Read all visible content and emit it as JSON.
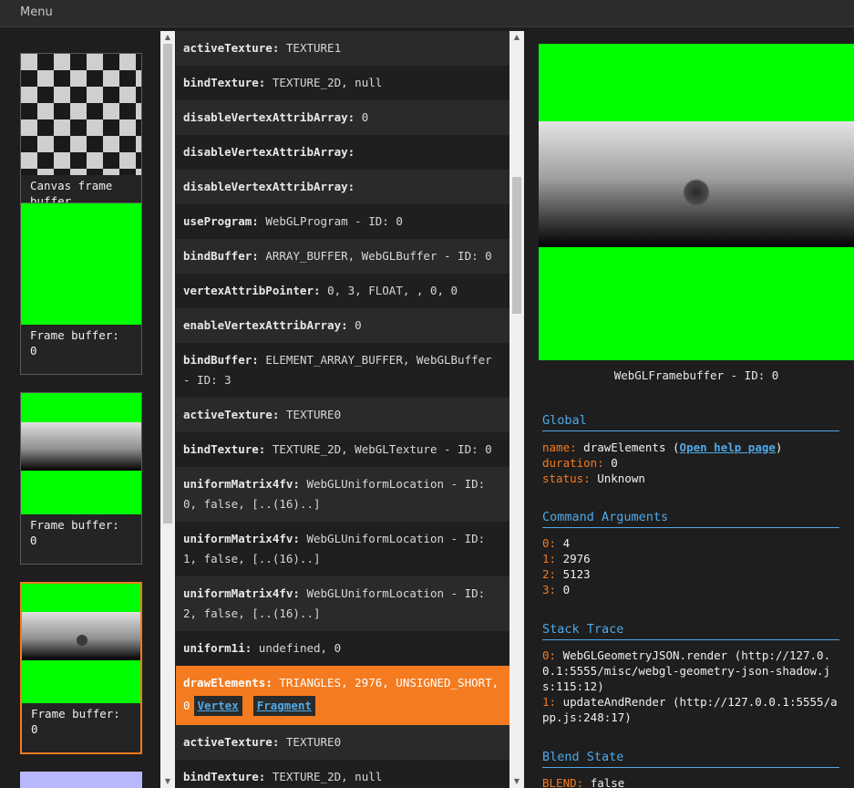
{
  "menu": {
    "label": "Menu"
  },
  "thumbnails": [
    {
      "label": "Canvas frame\nbuffer"
    },
    {
      "label": "Frame buffer:\n0"
    },
    {
      "label": "Frame buffer:\n0"
    },
    {
      "label": "Frame buffer:\n0"
    }
  ],
  "commands": [
    {
      "name": "activeTexture",
      "args": "TEXTURE1"
    },
    {
      "name": "bindTexture",
      "args": "TEXTURE_2D, null"
    },
    {
      "name": "disableVertexAttribArray",
      "args": "0"
    },
    {
      "name": "disableVertexAttribArray",
      "args": ""
    },
    {
      "name": "disableVertexAttribArray",
      "args": ""
    },
    {
      "name": "useProgram",
      "args": "WebGLProgram - ID: 0"
    },
    {
      "name": "bindBuffer",
      "args": "ARRAY_BUFFER, WebGLBuffer - ID: 0"
    },
    {
      "name": "vertexAttribPointer",
      "args": "0, 3, FLOAT, , 0, 0"
    },
    {
      "name": "enableVertexAttribArray",
      "args": "0"
    },
    {
      "name": "bindBuffer",
      "args": "ELEMENT_ARRAY_BUFFER, WebGLBuffer - ID: 3"
    },
    {
      "name": "activeTexture",
      "args": "TEXTURE0"
    },
    {
      "name": "bindTexture",
      "args": "TEXTURE_2D, WebGLTexture - ID: 0"
    },
    {
      "name": "uniformMatrix4fv",
      "args": "WebGLUniformLocation - ID: 0, false, [..(16)..]"
    },
    {
      "name": "uniformMatrix4fv",
      "args": "WebGLUniformLocation - ID: 1, false, [..(16)..]"
    },
    {
      "name": "uniformMatrix4fv",
      "args": "WebGLUniformLocation - ID: 2, false, [..(16)..]"
    },
    {
      "name": "uniform1i",
      "args": "undefined, 0"
    },
    {
      "name": "drawElements",
      "args": "TRIANGLES, 2976, UNSIGNED_SHORT, 0",
      "vertex": "Vertex",
      "fragment": "Fragment"
    },
    {
      "name": "activeTexture",
      "args": "TEXTURE0"
    },
    {
      "name": "bindTexture",
      "args": "TEXTURE_2D, null"
    }
  ],
  "preview": {
    "caption": "WebGLFramebuffer - ID: 0"
  },
  "global": {
    "title": "Global",
    "name_key": "name:",
    "name_value": "drawElements",
    "help_link": "Open help page",
    "duration_key": "duration:",
    "duration_value": "0",
    "status_key": "status:",
    "status_value": "Unknown"
  },
  "arguments": {
    "title": "Command Arguments",
    "items": [
      {
        "key": "0:",
        "value": "4"
      },
      {
        "key": "1:",
        "value": "2976"
      },
      {
        "key": "2:",
        "value": "5123"
      },
      {
        "key": "3:",
        "value": "0"
      }
    ]
  },
  "stack": {
    "title": "Stack Trace",
    "lines": [
      {
        "key": "0:",
        "value": "WebGLGeometryJSON.render (http://127.0.0.1:5555/misc/webgl-geometry-json-shadow.js:115:12)"
      },
      {
        "key": "1:",
        "value": "updateAndRender (http://127.0.0.1:5555/app.js:248:17)"
      }
    ]
  },
  "blend": {
    "title": "Blend State",
    "key": "BLEND:",
    "value": "false"
  },
  "colors": {
    "accent": "#f47b20",
    "link": "#4fa8e8",
    "framebuffer": "#00ff00"
  }
}
